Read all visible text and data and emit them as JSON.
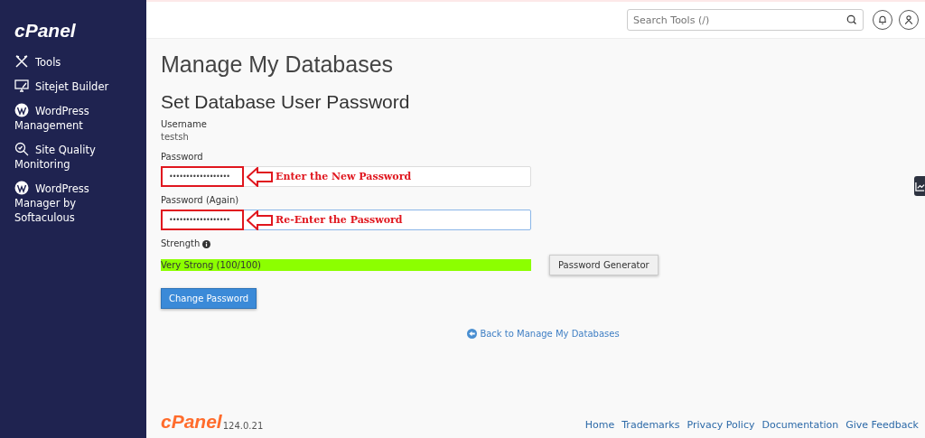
{
  "sidebar": {
    "logo": "cPanel",
    "items": [
      {
        "label": "Tools",
        "kind": "tools"
      },
      {
        "label": "Sitejet Builder",
        "kind": "monitor"
      },
      {
        "label": "WordPress Management",
        "kind": "wordpress"
      },
      {
        "label": "Site Quality Monitoring",
        "kind": "quality"
      },
      {
        "label": "WordPress Manager by Softaculous",
        "kind": "wordpress"
      }
    ]
  },
  "header": {
    "search": {
      "placeholder": "Search Tools (/)"
    }
  },
  "page": {
    "title": "Manage My Databases",
    "subtitle": "Set Database User Password",
    "username": {
      "label": "Username",
      "value": "testsh"
    },
    "fields": [
      {
        "label": "Password",
        "value": "••••••••••••••••••",
        "focused": false,
        "annotation": "Enter the New Password"
      },
      {
        "label": "Password (Again)",
        "value": "••••••••••••••••••",
        "focused": true,
        "annotation": "Re-Enter the Password"
      }
    ],
    "strength": {
      "label": "Strength",
      "reading": "Very Strong (100/100)",
      "level": 1
    },
    "generator_button": "Password Generator",
    "submit_button": "Change Password",
    "back_link": "Back to Manage My Databases"
  },
  "footer": {
    "logo": "cPanel",
    "version": "124.0.21",
    "links": [
      "Home",
      "Trademarks",
      "Privacy Policy",
      "Documentation",
      "Give Feedback"
    ]
  }
}
